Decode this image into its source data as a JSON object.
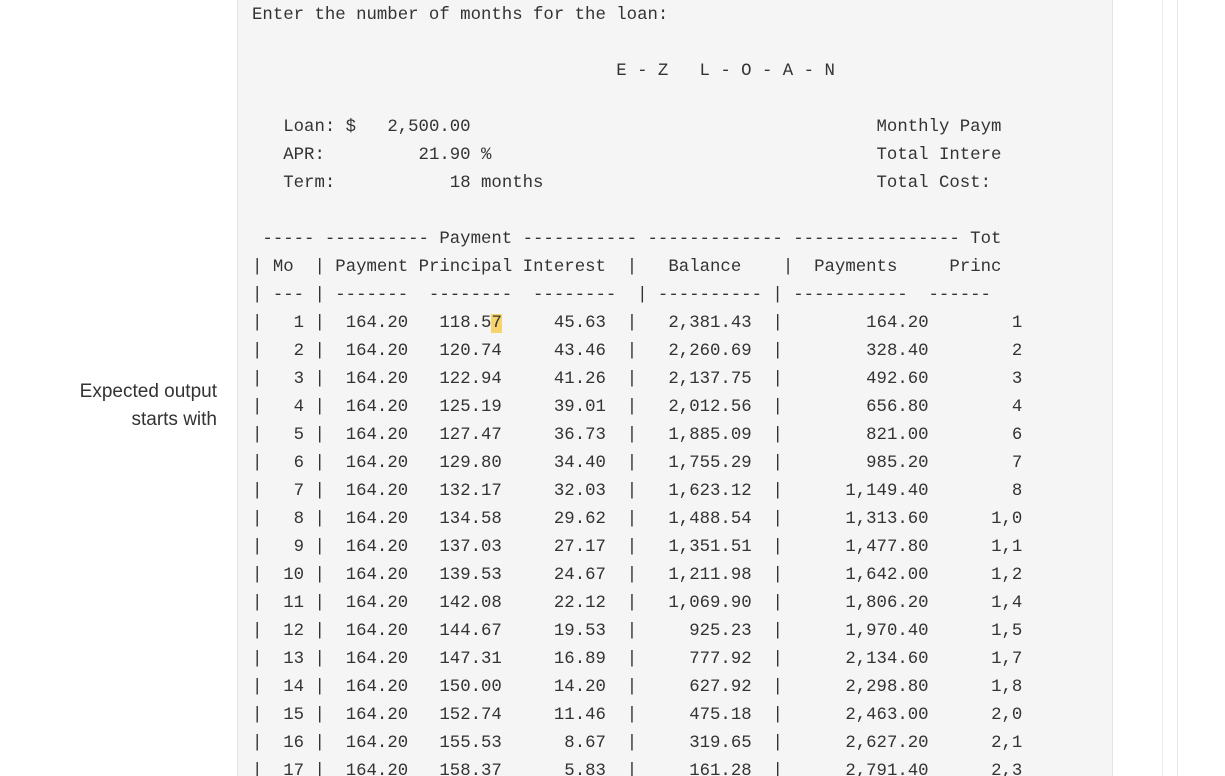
{
  "sidebar": {
    "label_line1": "Expected output",
    "label_line2": "starts with"
  },
  "output": {
    "prompt": "Enter the number of months for the loan:",
    "app_title": "E - Z   L - O - A - N",
    "summary": {
      "loan_label": "Loan: $",
      "loan_value": "2,500.00",
      "apr_label": "APR:",
      "apr_value": "21.90 %",
      "term_label": "Term:",
      "term_value": "18 months",
      "monthly_payment_label": "Monthly Paym",
      "total_interest_label": "Total Intere",
      "total_cost_label": "Total Cost:"
    },
    "group_header": {
      "payment_group": "Payment",
      "totals_group": "Tot"
    },
    "columns": [
      "Mo",
      "Payment",
      "Principal",
      "Interest",
      "Balance",
      "Payments",
      "Princ"
    ],
    "rows": [
      {
        "mo": "1",
        "payment": "164.20",
        "principal": "118.57",
        "interest": "45.63",
        "balance": "2,381.43",
        "payments": "164.20",
        "princ": "1"
      },
      {
        "mo": "2",
        "payment": "164.20",
        "principal": "120.74",
        "interest": "43.46",
        "balance": "2,260.69",
        "payments": "328.40",
        "princ": "2"
      },
      {
        "mo": "3",
        "payment": "164.20",
        "principal": "122.94",
        "interest": "41.26",
        "balance": "2,137.75",
        "payments": "492.60",
        "princ": "3"
      },
      {
        "mo": "4",
        "payment": "164.20",
        "principal": "125.19",
        "interest": "39.01",
        "balance": "2,012.56",
        "payments": "656.80",
        "princ": "4"
      },
      {
        "mo": "5",
        "payment": "164.20",
        "principal": "127.47",
        "interest": "36.73",
        "balance": "1,885.09",
        "payments": "821.00",
        "princ": "6"
      },
      {
        "mo": "6",
        "payment": "164.20",
        "principal": "129.80",
        "interest": "34.40",
        "balance": "1,755.29",
        "payments": "985.20",
        "princ": "7"
      },
      {
        "mo": "7",
        "payment": "164.20",
        "principal": "132.17",
        "interest": "32.03",
        "balance": "1,623.12",
        "payments": "1,149.40",
        "princ": "8"
      },
      {
        "mo": "8",
        "payment": "164.20",
        "principal": "134.58",
        "interest": "29.62",
        "balance": "1,488.54",
        "payments": "1,313.60",
        "princ": "1,0"
      },
      {
        "mo": "9",
        "payment": "164.20",
        "principal": "137.03",
        "interest": "27.17",
        "balance": "1,351.51",
        "payments": "1,477.80",
        "princ": "1,1"
      },
      {
        "mo": "10",
        "payment": "164.20",
        "principal": "139.53",
        "interest": "24.67",
        "balance": "1,211.98",
        "payments": "1,642.00",
        "princ": "1,2"
      },
      {
        "mo": "11",
        "payment": "164.20",
        "principal": "142.08",
        "interest": "22.12",
        "balance": "1,069.90",
        "payments": "1,806.20",
        "princ": "1,4"
      },
      {
        "mo": "12",
        "payment": "164.20",
        "principal": "144.67",
        "interest": "19.53",
        "balance": "925.23",
        "payments": "1,970.40",
        "princ": "1,5"
      },
      {
        "mo": "13",
        "payment": "164.20",
        "principal": "147.31",
        "interest": "16.89",
        "balance": "777.92",
        "payments": "2,134.60",
        "princ": "1,7"
      },
      {
        "mo": "14",
        "payment": "164.20",
        "principal": "150.00",
        "interest": "14.20",
        "balance": "627.92",
        "payments": "2,298.80",
        "princ": "1,8"
      },
      {
        "mo": "15",
        "payment": "164.20",
        "principal": "152.74",
        "interest": "11.46",
        "balance": "475.18",
        "payments": "2,463.00",
        "princ": "2,0"
      },
      {
        "mo": "16",
        "payment": "164.20",
        "principal": "155.53",
        "interest": "8.67",
        "balance": "319.65",
        "payments": "2,627.20",
        "princ": "2,1"
      },
      {
        "mo": "17",
        "payment": "164.20",
        "principal": "158.37",
        "interest": "5.83",
        "balance": "161.28",
        "payments": "2,791.40",
        "princ": "2,3"
      }
    ],
    "highlight": {
      "row": 0,
      "char_index": 5
    }
  }
}
